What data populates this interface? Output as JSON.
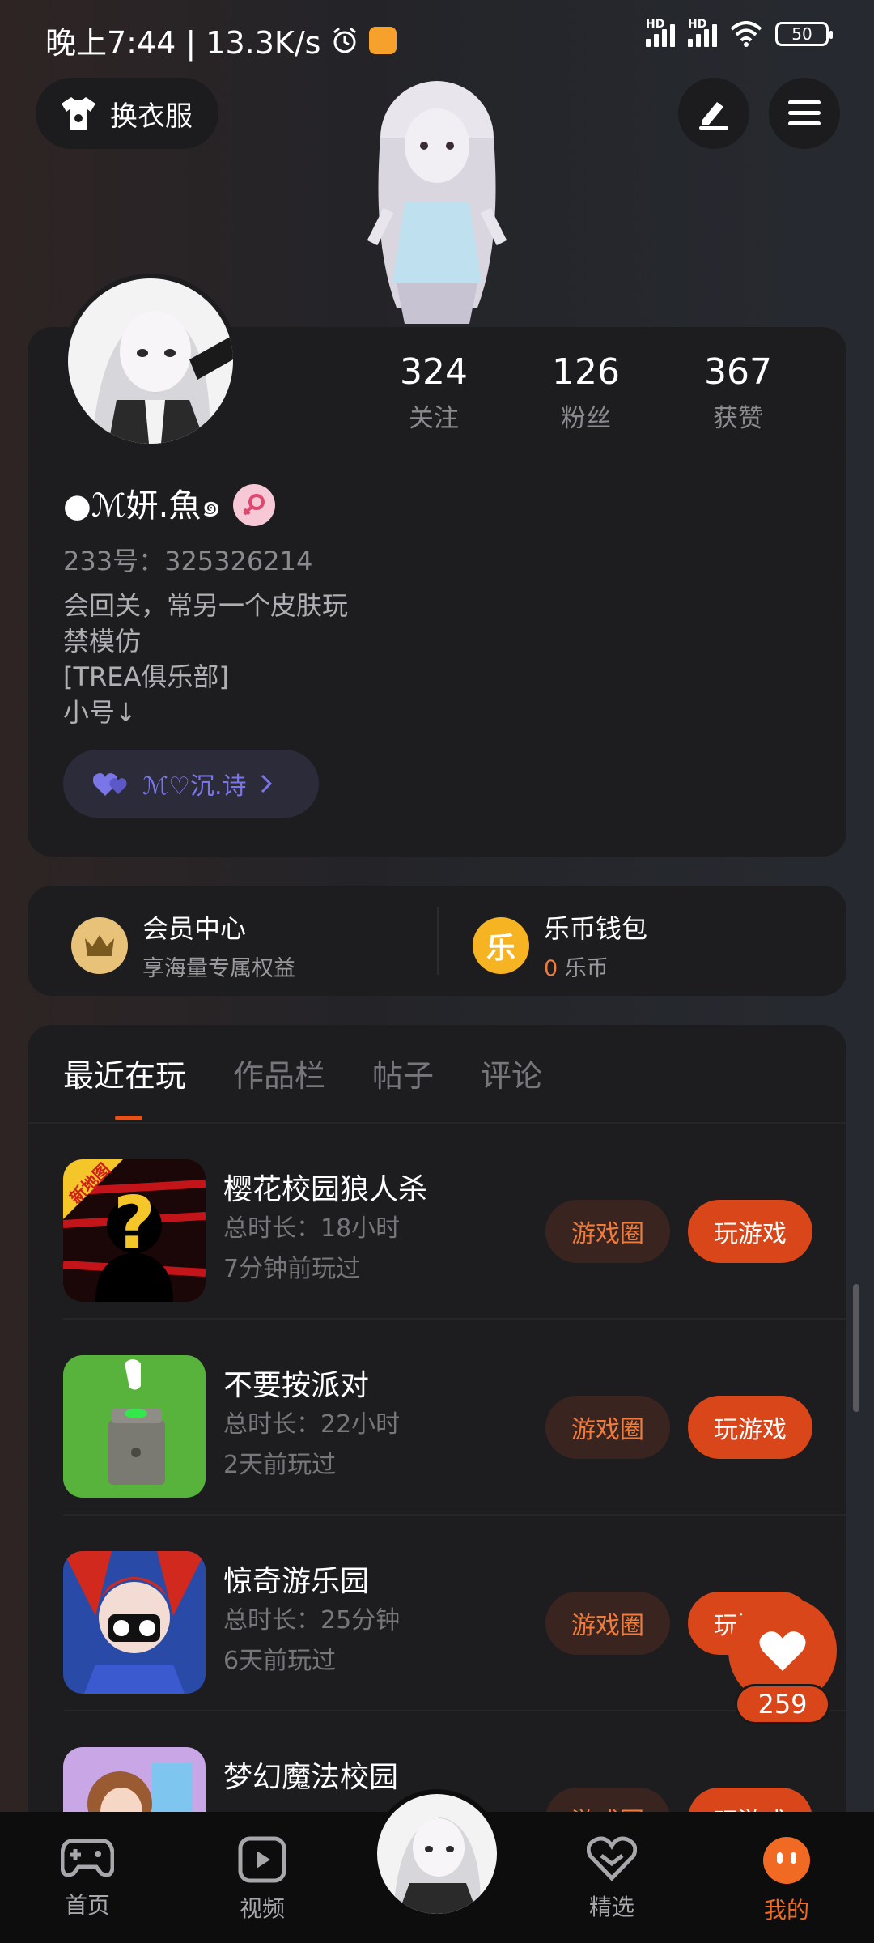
{
  "status_bar": {
    "time_speed": "晚上7:44 | 13.3K/s",
    "battery": "50",
    "hd1": "HD",
    "hd2": "HD"
  },
  "header": {
    "outfit_label": "换衣服"
  },
  "profile": {
    "stats": [
      {
        "value": "324",
        "label": "关注"
      },
      {
        "value": "126",
        "label": "粉丝"
      },
      {
        "value": "367",
        "label": "获赞"
      }
    ],
    "nickname": "●ℳ妍.魚๑",
    "user_id": "233号：325326214",
    "bio_lines": [
      "会回关，常另一个皮肤玩",
      "禁模仿",
      "[TREA俱乐部]",
      "小号↓"
    ],
    "relation_chip": "ℳ♡沉.诗"
  },
  "wallet": {
    "vip_title": "会员中心",
    "vip_sub": "享海量专属权益",
    "coin_icon_text": "乐",
    "coin_title": "乐币钱包",
    "coin_amount": "0",
    "coin_unit": "乐币"
  },
  "tabs": [
    {
      "label": "最近在玩",
      "active": true
    },
    {
      "label": "作品栏",
      "active": false
    },
    {
      "label": "帖子",
      "active": false
    },
    {
      "label": "评论",
      "active": false
    }
  ],
  "games": [
    {
      "name": "樱花校园狼人杀",
      "duration": "总时长：18小时",
      "last_played": "7分钟前玩过",
      "badge": "新地图",
      "circle_label": "游戏圈",
      "play_label": "玩游戏"
    },
    {
      "name": "不要按派对",
      "duration": "总时长：22小时",
      "last_played": "2天前玩过",
      "circle_label": "游戏圈",
      "play_label": "玩游戏"
    },
    {
      "name": "惊奇游乐园",
      "duration": "总时长：25分钟",
      "last_played": "6天前玩过",
      "circle_label": "游戏圈",
      "play_label": "玩游戏"
    },
    {
      "name": "梦幻魔法校园",
      "circle_label": "游戏圈",
      "play_label": "玩游戏"
    }
  ],
  "like_float": {
    "count": "259"
  },
  "bottom_nav": [
    {
      "label": "首页",
      "icon": "gamepad-icon"
    },
    {
      "label": "视频",
      "icon": "video-icon"
    },
    {
      "label": "精选",
      "icon": "heart-diamond-icon"
    },
    {
      "label": "我的",
      "icon": "profile-face-icon",
      "active": true
    }
  ],
  "colors": {
    "accent": "#d9461a",
    "background": "#1d1d1f"
  }
}
